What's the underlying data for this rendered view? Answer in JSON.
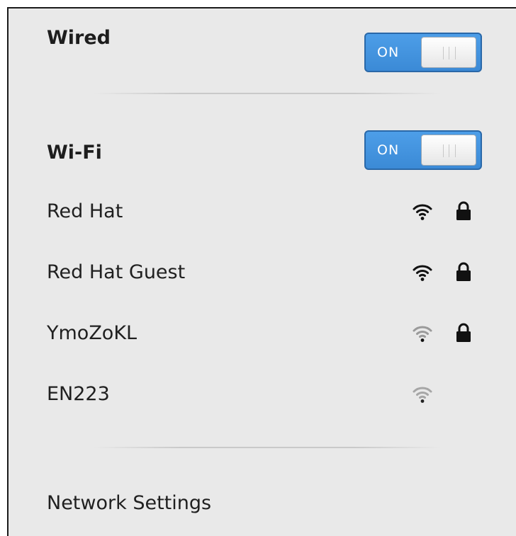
{
  "wired": {
    "title": "Wired",
    "switch_label": "ON",
    "switch_on": true
  },
  "wifi": {
    "title": "Wi-Fi",
    "switch_label": "ON",
    "switch_on": true,
    "networks": [
      {
        "name": "Red Hat",
        "signal": "strong",
        "signal_icon": "wifi-signal-icon",
        "secured": true,
        "lock_icon": "lock-icon"
      },
      {
        "name": "Red Hat Guest",
        "signal": "strong",
        "signal_icon": "wifi-signal-icon",
        "secured": true,
        "lock_icon": "lock-icon"
      },
      {
        "name": "YmoZoKL",
        "signal": "weak",
        "signal_icon": "wifi-signal-icon",
        "secured": true,
        "lock_icon": "lock-icon"
      },
      {
        "name": "EN223",
        "signal": "weak",
        "signal_icon": "wifi-signal-icon",
        "secured": false
      }
    ]
  },
  "footer": {
    "settings_label": "Network Settings"
  },
  "colors": {
    "menu_background": "#e9e9e9",
    "switch_accent": "#3b8ad6",
    "icon_strong": "#111111",
    "icon_weak": "#8e8e8e"
  }
}
